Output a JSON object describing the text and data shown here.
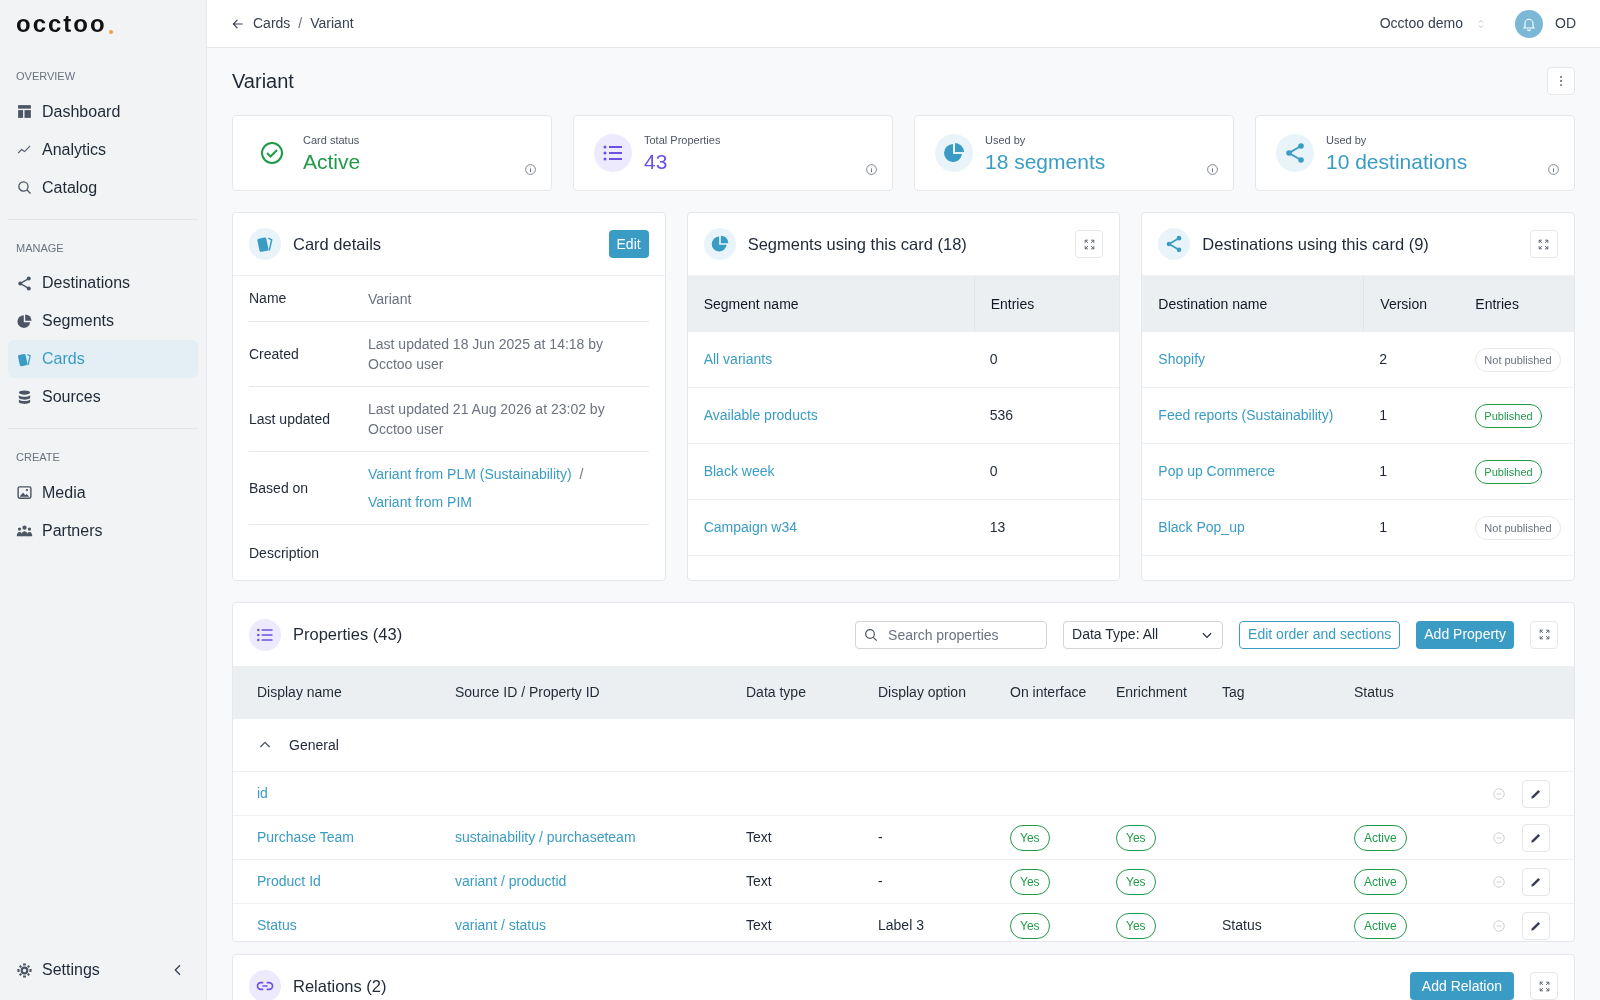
{
  "sidebar": {
    "logo": "occtoo",
    "sections": [
      {
        "label": "OVERVIEW",
        "items": [
          {
            "label": "Dashboard",
            "kind": "dashboard",
            "selected": false
          },
          {
            "label": "Analytics",
            "kind": "analytics",
            "selected": false
          },
          {
            "label": "Catalog",
            "kind": "catalog",
            "selected": false
          }
        ]
      },
      {
        "label": "MANAGE",
        "items": [
          {
            "label": "Destinations",
            "kind": "share",
            "selected": false
          },
          {
            "label": "Segments",
            "kind": "pie",
            "selected": false
          },
          {
            "label": "Cards",
            "kind": "cards",
            "selected": true
          },
          {
            "label": "Sources",
            "kind": "database",
            "selected": false
          }
        ]
      },
      {
        "label": "CREATE",
        "items": [
          {
            "label": "Media",
            "kind": "media",
            "selected": false
          },
          {
            "label": "Partners",
            "kind": "partners",
            "selected": false
          }
        ]
      }
    ],
    "footer": {
      "label": "Settings"
    }
  },
  "header": {
    "breadcrumb": [
      "Cards",
      "Variant"
    ],
    "breadcrumb_separator": "/",
    "workspace": "Occtoo demo",
    "user_initials": "OD"
  },
  "page": {
    "title": "Variant"
  },
  "stats": [
    {
      "kind": "status",
      "label": "Card status",
      "value": "Active"
    },
    {
      "kind": "properties",
      "label": "Total Properties",
      "value": "43"
    },
    {
      "kind": "segments",
      "label": "Used by",
      "value": "18 segments"
    },
    {
      "kind": "destinations",
      "label": "Used by",
      "value": "10 destinations"
    }
  ],
  "card_details": {
    "title": "Card details",
    "edit": "Edit",
    "rows": [
      {
        "label": "Name",
        "value": "Variant"
      },
      {
        "label": "Created",
        "value": "Last updated 18 Jun 2025 at 14:18 by Occtoo user"
      },
      {
        "label": "Last updated",
        "value": "Last updated 21 Aug 2026 at 23:02 by Occtoo user"
      },
      {
        "label": "Based on",
        "links": [
          "Variant from PLM (Sustainability)",
          "Variant from PIM"
        ],
        "separator": "/"
      },
      {
        "label": "Description"
      }
    ]
  },
  "segments": {
    "title": "Segments using this card (18)",
    "columns": [
      "Segment name",
      "Entries"
    ],
    "rows": [
      {
        "name": "All variants",
        "entries": "0"
      },
      {
        "name": "Available products",
        "entries": "536"
      },
      {
        "name": "Black week",
        "entries": "0"
      },
      {
        "name": "Campaign w34",
        "entries": "13"
      }
    ]
  },
  "destinations": {
    "title": "Destinations using this card (9)",
    "columns": [
      "Destination name",
      "Version",
      "Entries"
    ],
    "rows": [
      {
        "name": "Shopify",
        "version": "2",
        "entries": "Not published",
        "published": false
      },
      {
        "name": "Feed reports (Sustainability)",
        "version": "1",
        "entries": "Published",
        "published": true
      },
      {
        "name": "Pop up Commerce",
        "version": "1",
        "entries": "Published",
        "published": true
      },
      {
        "name": "Black Pop_up",
        "version": "1",
        "entries": "Not published",
        "published": false
      }
    ]
  },
  "properties": {
    "title": "Properties (43)",
    "search": {
      "placeholder": "Search properties"
    },
    "filter": "Data Type: All",
    "edit_order": "Edit order and sections",
    "add": "Add Property",
    "columns": [
      "Display name",
      "Source ID / Property ID",
      "Data type",
      "Display option",
      "On interface",
      "Enrichment",
      "Tag",
      "Status"
    ],
    "sections": [
      {
        "label": "General",
        "expanded": true,
        "rows": [
          {
            "display_name": "id"
          },
          {
            "display_name": "Purchase Team",
            "source": "sustainability / purchaseteam",
            "data_type": "Text",
            "display_option": "-",
            "on_interface": "Yes",
            "enrichment": "Yes",
            "status": "Active"
          },
          {
            "display_name": "Product Id",
            "source": "variant / productid",
            "data_type": "Text",
            "display_option": "-",
            "on_interface": "Yes",
            "enrichment": "Yes",
            "status": "Active"
          },
          {
            "display_name": "Status",
            "source": "variant / status",
            "data_type": "Text",
            "display_option": "Label 3",
            "on_interface": "Yes",
            "enrichment": "Yes",
            "tag": "Status",
            "status": "Active"
          }
        ]
      }
    ]
  },
  "relations": {
    "title": "Relations (2)",
    "add": "Add Relation"
  }
}
